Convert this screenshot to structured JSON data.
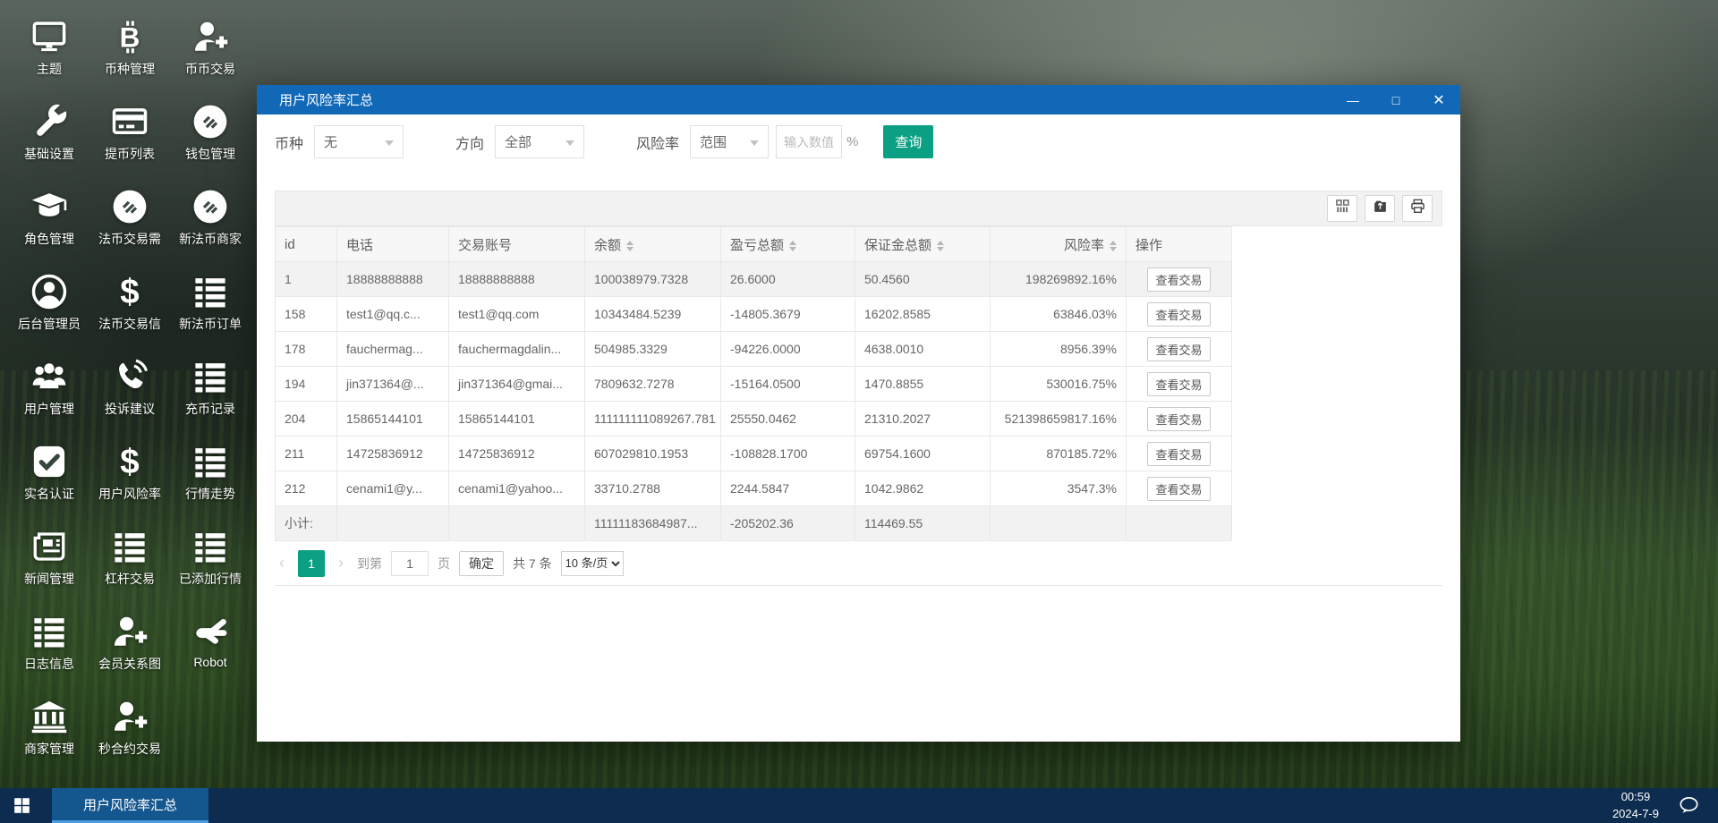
{
  "desktop": {
    "icons": [
      {
        "label": "主题",
        "icon": "monitor-icon"
      },
      {
        "label": "币种管理",
        "icon": "bitcoin-icon"
      },
      {
        "label": "币币交易",
        "icon": "user-plus-icon"
      },
      {
        "label": "基础设置",
        "icon": "wrench-icon"
      },
      {
        "label": "提币列表",
        "icon": "credit-card-icon"
      },
      {
        "label": "钱包管理",
        "icon": "coin-logo-icon"
      },
      {
        "label": "角色管理",
        "icon": "graduation-cap-icon"
      },
      {
        "label": "法币交易需",
        "icon": "coin-logo-icon"
      },
      {
        "label": "新法币商家",
        "icon": "coin-logo-icon"
      },
      {
        "label": "后台管理员",
        "icon": "user-circle-icon"
      },
      {
        "label": "法币交易信",
        "icon": "dollar-icon"
      },
      {
        "label": "新法币订单",
        "icon": "list-icon"
      },
      {
        "label": "用户管理",
        "icon": "users-icon"
      },
      {
        "label": "投诉建议",
        "icon": "phone-icon"
      },
      {
        "label": "充币记录",
        "icon": "list-icon"
      },
      {
        "label": "实名认证",
        "icon": "check-square-icon"
      },
      {
        "label": "用户风险率",
        "icon": "dollar-icon"
      },
      {
        "label": "行情走势",
        "icon": "list-icon"
      },
      {
        "label": "新闻管理",
        "icon": "newspaper-icon"
      },
      {
        "label": "杠杆交易",
        "icon": "list-icon"
      },
      {
        "label": "已添加行情",
        "icon": "list-icon"
      },
      {
        "label": "日志信息",
        "icon": "list-icon"
      },
      {
        "label": "会员关系图",
        "icon": "user-plus-icon"
      },
      {
        "label": "Robot",
        "icon": "robot-hand-icon"
      },
      {
        "label": "商家管理",
        "icon": "bank-icon"
      },
      {
        "label": "秒合约交易",
        "icon": "user-plus-icon"
      }
    ]
  },
  "window": {
    "title": "用户风险率汇总",
    "controls": [
      {
        "name": "minimize",
        "glyph": "—"
      },
      {
        "name": "maximize",
        "glyph": "□"
      },
      {
        "name": "close",
        "glyph": "✕"
      }
    ],
    "filters": {
      "currency_label": "币种",
      "currency_value": "无",
      "direction_label": "方向",
      "direction_value": "全部",
      "risk_label": "风险率",
      "risk_mode_value": "范围",
      "risk_input_placeholder": "输入数值",
      "percent_suffix": "%",
      "search_button": "查询"
    },
    "toolbar": {
      "buttons": [
        {
          "name": "filter-columns",
          "icon": "columns-icon"
        },
        {
          "name": "export",
          "icon": "export-icon"
        },
        {
          "name": "print",
          "icon": "print-icon"
        }
      ]
    },
    "table": {
      "columns": [
        {
          "label": "id",
          "sortable": false,
          "align": "left"
        },
        {
          "label": "电话",
          "sortable": false,
          "align": "left"
        },
        {
          "label": "交易账号",
          "sortable": false,
          "align": "left"
        },
        {
          "label": "余额",
          "sortable": true,
          "align": "left"
        },
        {
          "label": "盈亏总额",
          "sortable": true,
          "align": "left"
        },
        {
          "label": "保证金总额",
          "sortable": true,
          "align": "left"
        },
        {
          "label": "风险率",
          "sortable": true,
          "align": "right"
        },
        {
          "label": "操作",
          "sortable": false,
          "align": "left"
        }
      ],
      "rows": [
        [
          "1",
          "18888888888",
          "18888888888",
          "100038979.7328",
          "26.6000",
          "50.4560",
          "198269892.16%"
        ],
        [
          "158",
          "test1@qq.c...",
          "test1@qq.com",
          "10343484.5239",
          "-14805.3679",
          "16202.8585",
          "63846.03%"
        ],
        [
          "178",
          "fauchermag...",
          "fauchermagdalin...",
          "504985.3329",
          "-94226.0000",
          "4638.0010",
          "8956.39%"
        ],
        [
          "194",
          "jin371364@...",
          "jin371364@gmai...",
          "7809632.7278",
          "-15164.0500",
          "1470.8855",
          "530016.75%"
        ],
        [
          "204",
          "15865144101",
          "15865144101",
          "111111111089267.781",
          "25550.0462",
          "21310.2027",
          "521398659817.16%"
        ],
        [
          "211",
          "14725836912",
          "14725836912",
          "607029810.1953",
          "-108828.1700",
          "69754.1600",
          "870185.72%"
        ],
        [
          "212",
          "cenami1@y...",
          "cenami1@yahoo...",
          "33710.2788",
          "2244.5847",
          "1042.9862",
          "3547.3%"
        ]
      ],
      "action_label": "查看交易",
      "subtotal": {
        "label": "小计:",
        "balance": "11111183684987...",
        "profit": "-205202.36",
        "margin": "114469.55"
      }
    },
    "pagination": {
      "prev": "‹",
      "next": "›",
      "page": "1",
      "goto_label": "到第",
      "goto_value": "1",
      "page_unit": "页",
      "confirm_label": "确定",
      "total_label": "共 7 条",
      "per_page_options": [
        "10 条/页"
      ]
    }
  },
  "taskbar": {
    "task_label": "用户风险率汇总",
    "time": "00:59",
    "date": "2024-7-9"
  },
  "colors": {
    "titlebar": "#1068b7",
    "accent_teal": "#0ba083",
    "taskbar": "#0d2c4f"
  }
}
